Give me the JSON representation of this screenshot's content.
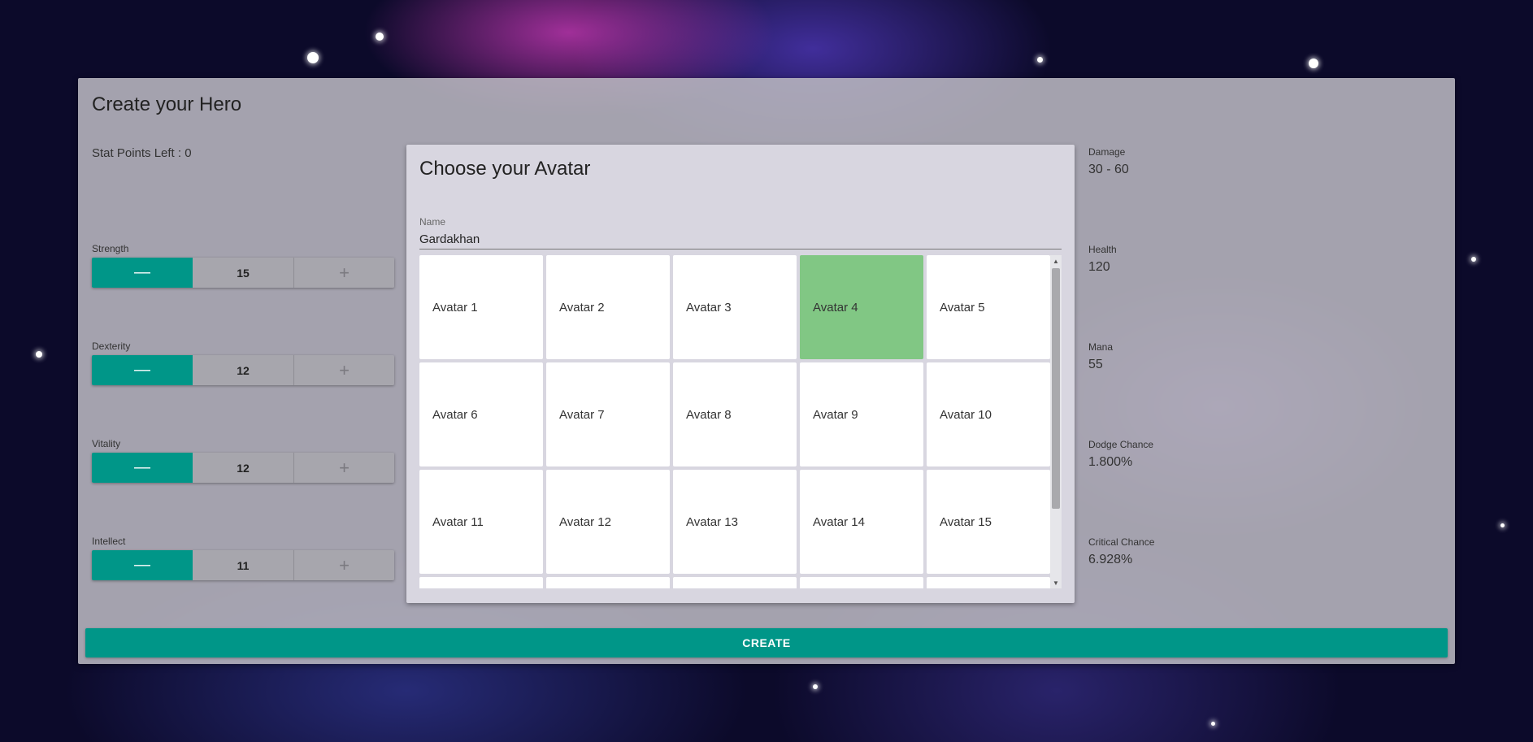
{
  "header": {
    "title": "Create your Hero"
  },
  "stat_points": {
    "label": "Stat Points Left : 0"
  },
  "stats": [
    {
      "label": "Strength",
      "value": "15",
      "minus": "—",
      "plus": "+"
    },
    {
      "label": "Dexterity",
      "value": "12",
      "minus": "—",
      "plus": "+"
    },
    {
      "label": "Vitality",
      "value": "12",
      "minus": "—",
      "plus": "+"
    },
    {
      "label": "Intellect",
      "value": "11",
      "minus": "—",
      "plus": "+"
    }
  ],
  "avatar_panel": {
    "title": "Choose your Avatar",
    "name_label": "Name",
    "name_value": "Gardakhan",
    "selected": "Avatar 4",
    "avatars": [
      "Avatar 1",
      "Avatar 2",
      "Avatar 3",
      "Avatar 4",
      "Avatar 5",
      "Avatar 6",
      "Avatar 7",
      "Avatar 8",
      "Avatar 9",
      "Avatar 10",
      "Avatar 11",
      "Avatar 12",
      "Avatar 13",
      "Avatar 14",
      "Avatar 15",
      "",
      "",
      "",
      "",
      ""
    ],
    "scroll_up_icon": "triangle-up-icon",
    "scroll_down_icon": "triangle-down-icon"
  },
  "derived_stats": [
    {
      "label": "Damage",
      "value": "30 - 60"
    },
    {
      "label": "Health",
      "value": "120"
    },
    {
      "label": "Mana",
      "value": "55"
    },
    {
      "label": "Dodge Chance",
      "value": "1.800%"
    },
    {
      "label": "Critical Chance",
      "value": "6.928%"
    }
  ],
  "create_button": {
    "label": "CREATE"
  },
  "colors": {
    "accent": "#009688",
    "selected_tile": "#81c784"
  }
}
